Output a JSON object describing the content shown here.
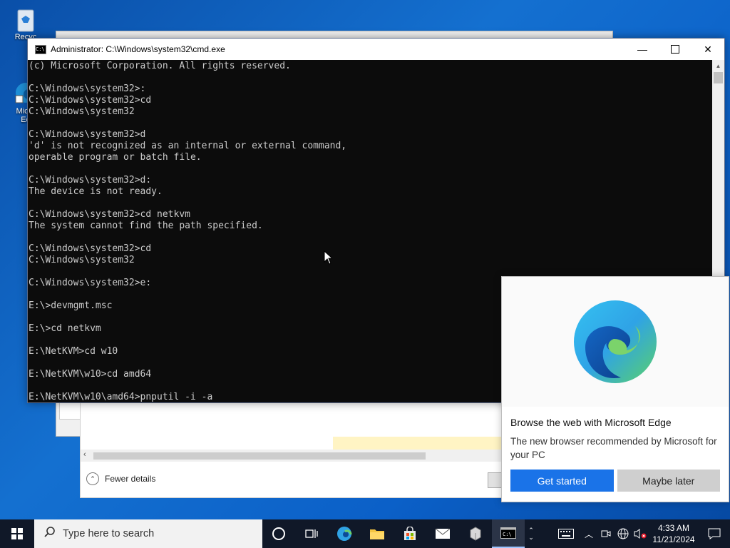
{
  "desktop": {
    "recycle_bin_label": "Recyc",
    "edge_label_line1": "Micro",
    "edge_label_line2": "Ed"
  },
  "cmd": {
    "title": "Administrator: C:\\Windows\\system32\\cmd.exe",
    "lines": [
      "(c) Microsoft Corporation. All rights reserved.",
      "",
      "C:\\Windows\\system32>:",
      "C:\\Windows\\system32>cd",
      "C:\\Windows\\system32",
      "",
      "C:\\Windows\\system32>d",
      "'d' is not recognized as an internal or external command,",
      "operable program or batch file.",
      "",
      "C:\\Windows\\system32>d:",
      "The device is not ready.",
      "",
      "C:\\Windows\\system32>cd netkvm",
      "The system cannot find the path specified.",
      "",
      "C:\\Windows\\system32>cd",
      "C:\\Windows\\system32",
      "",
      "C:\\Windows\\system32>e:",
      "",
      "E:\\>devmgmt.msc",
      "",
      "E:\\>cd netkvm",
      "",
      "E:\\NetKVM>cd w10",
      "",
      "E:\\NetKVM\\w10>cd amd64",
      "",
      "E:\\NetKVM\\w10\\amd64>pnputil -i -a"
    ]
  },
  "task_manager": {
    "fewer_details": "Fewer details"
  },
  "edge_popup": {
    "heading": "Browse the web with Microsoft Edge",
    "body": "The new browser recommended by Microsoft for your PC",
    "get_started": "Get started",
    "maybe_later": "Maybe later"
  },
  "taskbar": {
    "search_placeholder": "Type here to search",
    "time": "4:33 AM",
    "date": "11/21/2024"
  },
  "colors": {
    "accent": "#1a73e8",
    "console_bg": "#0c0c0c",
    "console_fg": "#cccccc",
    "taskbar_bg": "#101828"
  }
}
